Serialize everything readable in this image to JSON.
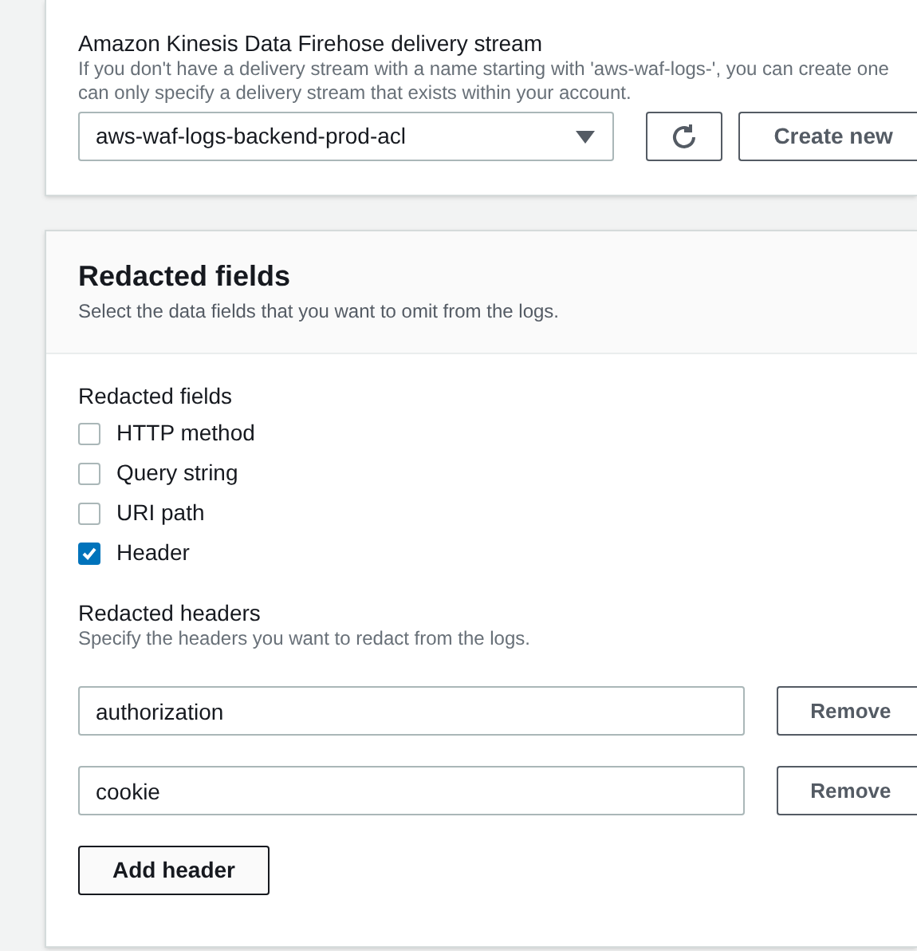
{
  "stream": {
    "label": "Amazon Kinesis Data Firehose delivery stream",
    "description_lines": [
      "If you don't have a delivery stream with a name starting with 'aws-waf-logs-', you can create one",
      "can only specify a delivery stream that exists within your account."
    ],
    "selected_value": "aws-waf-logs-backend-prod-acl",
    "create_button": "Create new"
  },
  "redacted": {
    "title": "Redacted fields",
    "description": "Select the data fields that you want to omit from the logs.",
    "fields_label": "Redacted fields",
    "fields": [
      {
        "label": "HTTP method",
        "checked": false
      },
      {
        "label": "Query string",
        "checked": false
      },
      {
        "label": "URI path",
        "checked": false
      },
      {
        "label": "Header",
        "checked": true
      }
    ],
    "headers_label": "Redacted headers",
    "headers_description": "Specify the headers you want to redact from the logs.",
    "headers": [
      {
        "value": "authorization",
        "remove": "Remove"
      },
      {
        "value": "cookie",
        "remove": "Remove"
      }
    ],
    "add_button": "Add header"
  }
}
